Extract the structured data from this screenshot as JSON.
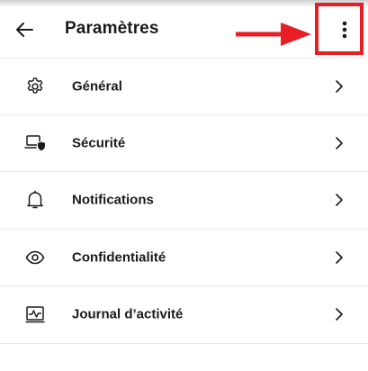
{
  "header": {
    "title": "Paramètres",
    "back_icon": "arrow-left-icon",
    "more_icon": "more-vertical-icon"
  },
  "annotation": {
    "arrow_color": "#e81e25",
    "box_color": "#e81e25"
  },
  "settings": {
    "items": [
      {
        "label": "Général",
        "icon": "gear-icon"
      },
      {
        "label": "Sécurité",
        "icon": "laptop-shield-icon"
      },
      {
        "label": "Notifications",
        "icon": "bell-icon"
      },
      {
        "label": "Confidentialité",
        "icon": "eye-icon"
      },
      {
        "label": "Journal d’activité",
        "icon": "activity-log-icon"
      }
    ],
    "chevron_icon": "chevron-right-icon"
  }
}
